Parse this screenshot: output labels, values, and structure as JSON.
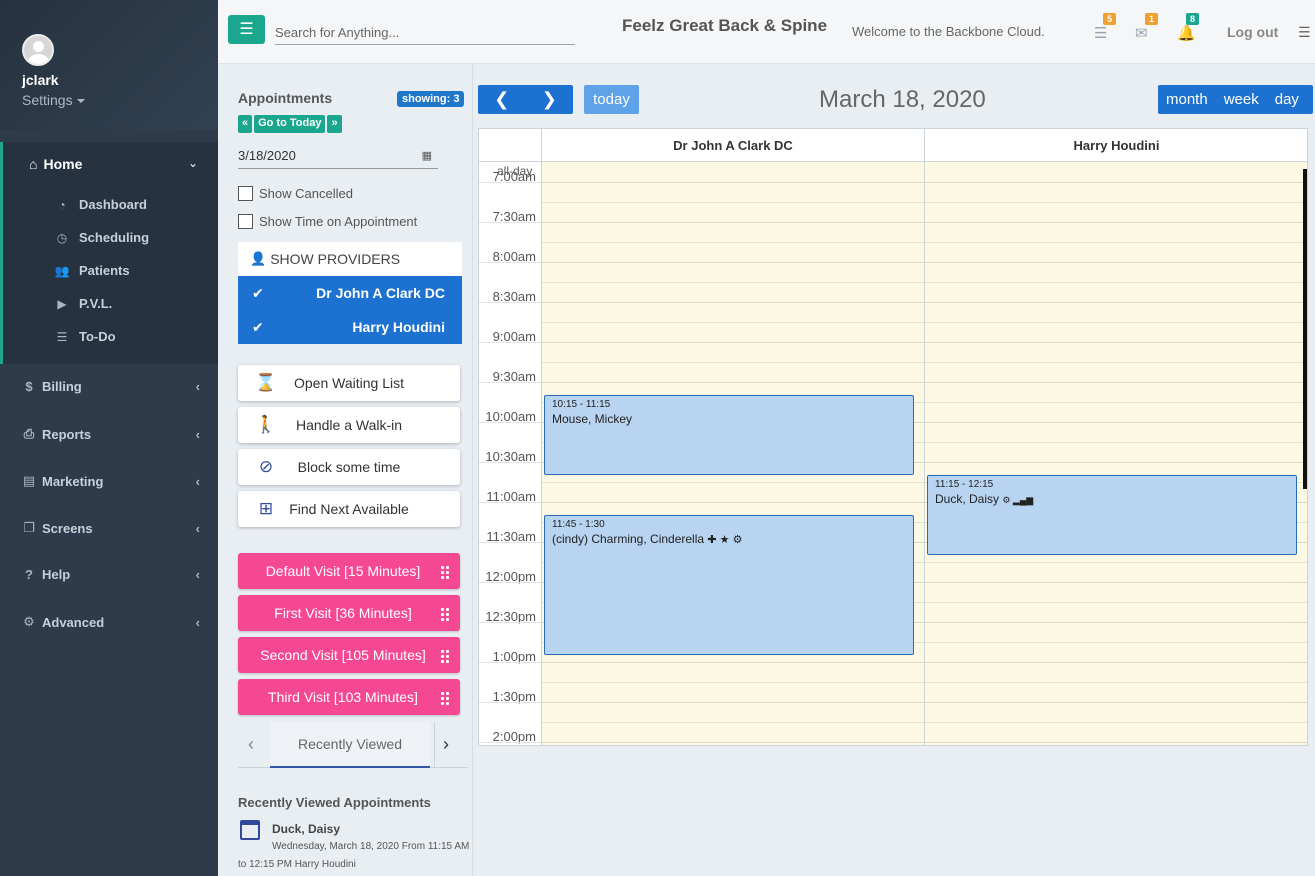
{
  "sidebar": {
    "username": "jclark",
    "settings_label": "Settings",
    "home": {
      "label": "Home",
      "icon": "home-icon"
    },
    "home_items": [
      {
        "label": "Dashboard",
        "icon": "dashboard-icon"
      },
      {
        "label": "Scheduling",
        "icon": "clock-icon"
      },
      {
        "label": "Patients",
        "icon": "users-icon"
      },
      {
        "label": "P.V.L.",
        "icon": "play-circle-icon"
      },
      {
        "label": "To-Do",
        "icon": "list-icon"
      }
    ],
    "menu": [
      {
        "label": "Billing",
        "icon": "dollar-icon"
      },
      {
        "label": "Reports",
        "icon": "printer-icon"
      },
      {
        "label": "Marketing",
        "icon": "scroll-icon"
      },
      {
        "label": "Screens",
        "icon": "copy-icon"
      },
      {
        "label": "Help",
        "icon": "question-circle-icon"
      },
      {
        "label": "Advanced",
        "icon": "gears-icon"
      }
    ]
  },
  "header": {
    "search_placeholder": "Search for Anything...",
    "brand": "Feelz Great Back & Spine",
    "welcome": "Welcome to the Backbone Cloud.",
    "badges": {
      "tasks": "5",
      "messages": "1",
      "notifications": "8"
    },
    "logout": "Log out"
  },
  "panel": {
    "title": "Appointments",
    "showing": "showing: 3",
    "goto_today": "Go to Today",
    "date_value": "3/18/2020",
    "show_cancelled": "Show Cancelled",
    "show_time": "Show Time on Appointment",
    "show_providers": "SHOW PROVIDERS",
    "providers": [
      "Dr John A Clark DC",
      "Harry Houdini"
    ],
    "actions": [
      "Open Waiting List",
      "Handle a Walk-in",
      "Block some time",
      "Find Next Available"
    ],
    "visits": [
      "Default Visit [15 Minutes]",
      "First Visit [36 Minutes]",
      "Second Visit [105 Minutes]",
      "Third Visit [103 Minutes]"
    ],
    "recent_tab": "Recently Viewed",
    "recent_title": "Recently Viewed Appointments",
    "recent": {
      "name": "Duck, Daisy",
      "line1": "Wednesday, March 18, 2020 From 11:15 AM",
      "line2": "to 12:15 PM Harry Houdini"
    }
  },
  "calendar": {
    "today_label": "today",
    "title": "March 18, 2020",
    "views": [
      "month",
      "week",
      "day"
    ],
    "columns": [
      "Dr John A Clark DC",
      "Harry Houdini"
    ],
    "allday_label": "all-day",
    "slots": [
      "7:00am",
      "7:30am",
      "8:00am",
      "8:30am",
      "9:00am",
      "9:30am",
      "10:00am",
      "10:30am",
      "11:00am",
      "11:30am",
      "12:00pm",
      "12:30pm",
      "1:00pm",
      "1:30pm",
      "2:00pm"
    ],
    "events": [
      {
        "time": "10:15 - 11:15",
        "title": "Mouse, Mickey",
        "icons": ""
      },
      {
        "time": "11:45 - 1:30",
        "title": "(cindy) Charming, Cinderella",
        "icons": "✚ ★ ⚙"
      },
      {
        "time": "11:15 - 12:15",
        "title": "Duck, Daisy",
        "icons": "⚙ ▂▄▆"
      }
    ]
  },
  "colors": {
    "accent_teal": "#1aa78e",
    "primary_blue": "#1d72d1",
    "visit_pink": "#f54892",
    "sidebar_bg": "#2d3b4a",
    "event_bg": "#b8d4f0"
  }
}
